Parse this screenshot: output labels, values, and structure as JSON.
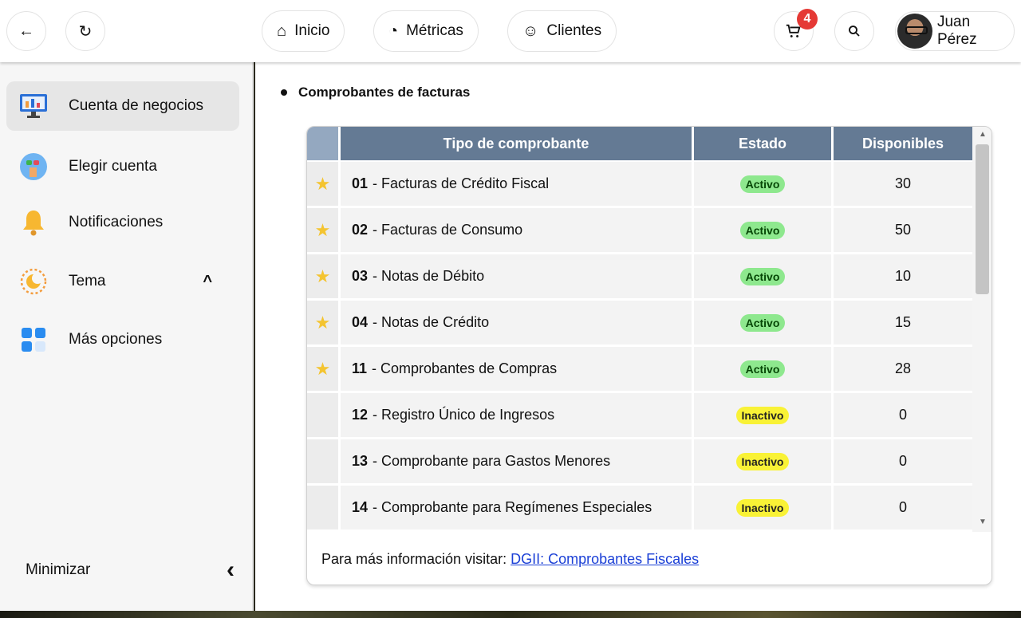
{
  "topbar": {
    "back_icon": "arrow-left-icon",
    "reload_icon": "refresh-icon",
    "nav": [
      {
        "label": "Inicio",
        "icon": "home-icon"
      },
      {
        "label": "Métricas",
        "icon": "pie-chart-icon"
      },
      {
        "label": "Clientes",
        "icon": "add-user-icon"
      }
    ],
    "cart_count": "4",
    "user_name": "Juan Pérez"
  },
  "sidebar": {
    "items": [
      {
        "label": "Cuenta de negocios",
        "icon": "monitor-chart-icon",
        "active": true
      },
      {
        "label": "Elegir cuenta",
        "icon": "hand-pick-icon"
      },
      {
        "label": "Notificaciones",
        "icon": "bell-icon"
      },
      {
        "label": "Tema",
        "icon": "sun-moon-icon"
      },
      {
        "label": "Más opciones",
        "icon": "grid-icon"
      }
    ],
    "tema_chevron": "^",
    "minimize_label": "Minimizar",
    "minimize_chevron": "‹"
  },
  "main": {
    "section_title": "Comprobantes de facturas",
    "table": {
      "headers": [
        "Tipo de comprobante",
        "Estado",
        "Disponibles"
      ],
      "rows": [
        {
          "code": "01",
          "name": "- Facturas de Crédito Fiscal",
          "state": "Activo",
          "available": "30",
          "starred": true
        },
        {
          "code": "02",
          "name": "- Facturas de Consumo",
          "state": "Activo",
          "available": "50",
          "starred": true
        },
        {
          "code": "03",
          "name": "- Notas de Débito",
          "state": "Activo",
          "available": "10",
          "starred": true
        },
        {
          "code": "04",
          "name": "- Notas de Crédito",
          "state": "Activo",
          "available": "15",
          "starred": true
        },
        {
          "code": "11",
          "name": "- Comprobantes de Compras",
          "state": "Activo",
          "available": "28",
          "starred": true
        },
        {
          "code": "12",
          "name": "- Registro Único de Ingresos",
          "state": "Inactivo",
          "available": "0",
          "starred": false
        },
        {
          "code": "13",
          "name": "- Comprobante para Gastos Menores",
          "state": "Inactivo",
          "available": "0",
          "starred": false
        },
        {
          "code": "14",
          "name": "- Comprobante para Regímenes Especiales",
          "state": "Inactivo",
          "available": "0",
          "starred": false
        }
      ]
    },
    "footer": {
      "text": "Para más información visitar:",
      "link_label": "DGII: Comprobantes Fiscales"
    }
  },
  "colors": {
    "header_bg": "#647a94",
    "active_badge": "#8ee88e",
    "inactive_badge": "#f9f236",
    "cart_badge": "#e53935",
    "link": "#1a3fd6"
  }
}
